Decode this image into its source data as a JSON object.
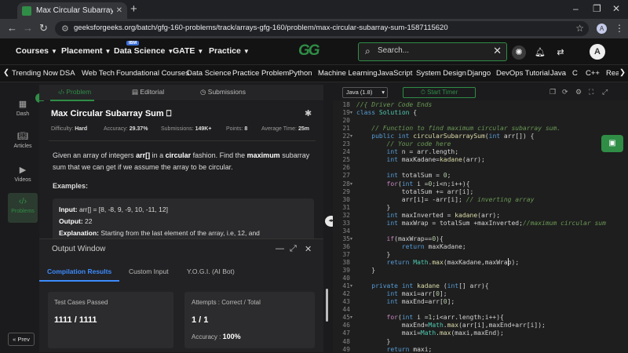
{
  "browser": {
    "tab_title": "Max Circular Subarray Sum | Pra",
    "new_tab": "+",
    "url_icon": "site-info",
    "url": "geeksforgeeks.org/batch/gfg-160-problems/track/arrays-gfg-160/problem/max-circular-subarray-sum-1587115620",
    "profile_initial": "A"
  },
  "header": {
    "menus": [
      "Courses",
      "Placement",
      "Data Science",
      "GATE",
      "Practice"
    ],
    "badge": "IBM",
    "logo": "GG",
    "search_placeholder": "Search...",
    "user_initial": "A"
  },
  "categories": [
    "Trending Now",
    "DSA",
    "Web Tech",
    "Foundational Courses",
    "Data Science",
    "Practice Problem",
    "Python",
    "Machine Learning",
    "JavaScript",
    "System Design",
    "Django",
    "DevOps Tutorial",
    "Java",
    "C",
    "C++",
    "Rea"
  ],
  "rail": {
    "items": [
      "Dash",
      "Articles",
      "Videos",
      "Problems"
    ],
    "prev": "« Prev"
  },
  "problem_tabs": [
    "Problem",
    "Editorial",
    "Submissions"
  ],
  "problem": {
    "title": "Max Circular Subarray Sum",
    "difficulty_label": "Difficulty:",
    "difficulty": "Hard",
    "accuracy_label": "Accuracy:",
    "accuracy": "29.37%",
    "submissions_label": "Submissions:",
    "submissions": "149K+",
    "points_label": "Points:",
    "points": "8",
    "avg_label": "Average Time:",
    "avg": "25m",
    "desc1_a": "Given an array of integers ",
    "desc1_b": "arr[]",
    "desc1_c": " in a ",
    "desc1_d": "circular",
    "desc1_e": " fashion. Find the ",
    "desc1_f": "maximum",
    "desc1_g": " subarray",
    "desc2": "sum that we can get if we assume the array to be circular.",
    "examples": "Examples:",
    "input_label": "Input:",
    "input": " arr[] = [8, -8, 9, -9, 10, -11, 12]",
    "output_label": "Output:",
    "output": " 22",
    "expl_label": "Explanation:",
    "expl": " Starting from the last element of the array, i.e, 12, and"
  },
  "output_window": {
    "title": "Output Window",
    "tabs": [
      "Compilation Results",
      "Custom Input",
      "Y.O.G.I. (AI Bot)"
    ],
    "passed_label": "Test Cases Passed",
    "passed": "1111 / 1111",
    "attempts_label": "Attempts : Correct / Total",
    "attempts": "1 / 1",
    "accuracy_label": "Accuracy : ",
    "accuracy": "100%"
  },
  "editor": {
    "language": "Java (1.8)",
    "timer": "Start Timer",
    "line_numbers": [
      "18",
      "19",
      "20",
      "21",
      "22",
      "23",
      "24",
      "25",
      "26",
      "27",
      "28",
      "29",
      "30",
      "31",
      "32",
      "33",
      "34",
      "35",
      "36",
      "37",
      "38",
      "39",
      "40",
      "41",
      "42",
      "43",
      "44",
      "45",
      "46",
      "47",
      "48",
      "49"
    ],
    "lines": [
      "//{ Driver Code Ends",
      "class Solution {",
      "",
      "    // Function to find maximum circular subarray sum.",
      "    public int circularSubarraySum(int arr[]) {",
      "        // Your code here",
      "        int n = arr.length;",
      "        int maxKadane=kadane(arr);",
      "",
      "        int totalSum = 0;",
      "        for(int i =0;i<n;i++){",
      "            totalSum += arr[i];",
      "            arr[i]= -arr[i]; // inverting array",
      "        }",
      "        int maxInverted = kadane(arr);",
      "        int maxWrap = totalSum +maxInverted;//maximum circular sum",
      "",
      "        if(maxWrap==0){",
      "            return maxKadane;",
      "        }",
      "        return Math.max(maxKadane,maxWrap);",
      "    }",
      "",
      "    private int kadane (int[] arr){",
      "        int maxi=arr[0];",
      "        int maxEnd=arr[0];",
      "",
      "        for(int i =1;i<arr.length;i++){",
      "            maxEnd=Math.max(arr[i],maxEnd+arr[i]);",
      "            maxi=Math.max(maxi,maxEnd);",
      "        }",
      "        return maxi;"
    ]
  },
  "colors": {
    "accent": "#2f8d46",
    "blue": "#3d8bfd",
    "bg": "#1b1b1d"
  }
}
